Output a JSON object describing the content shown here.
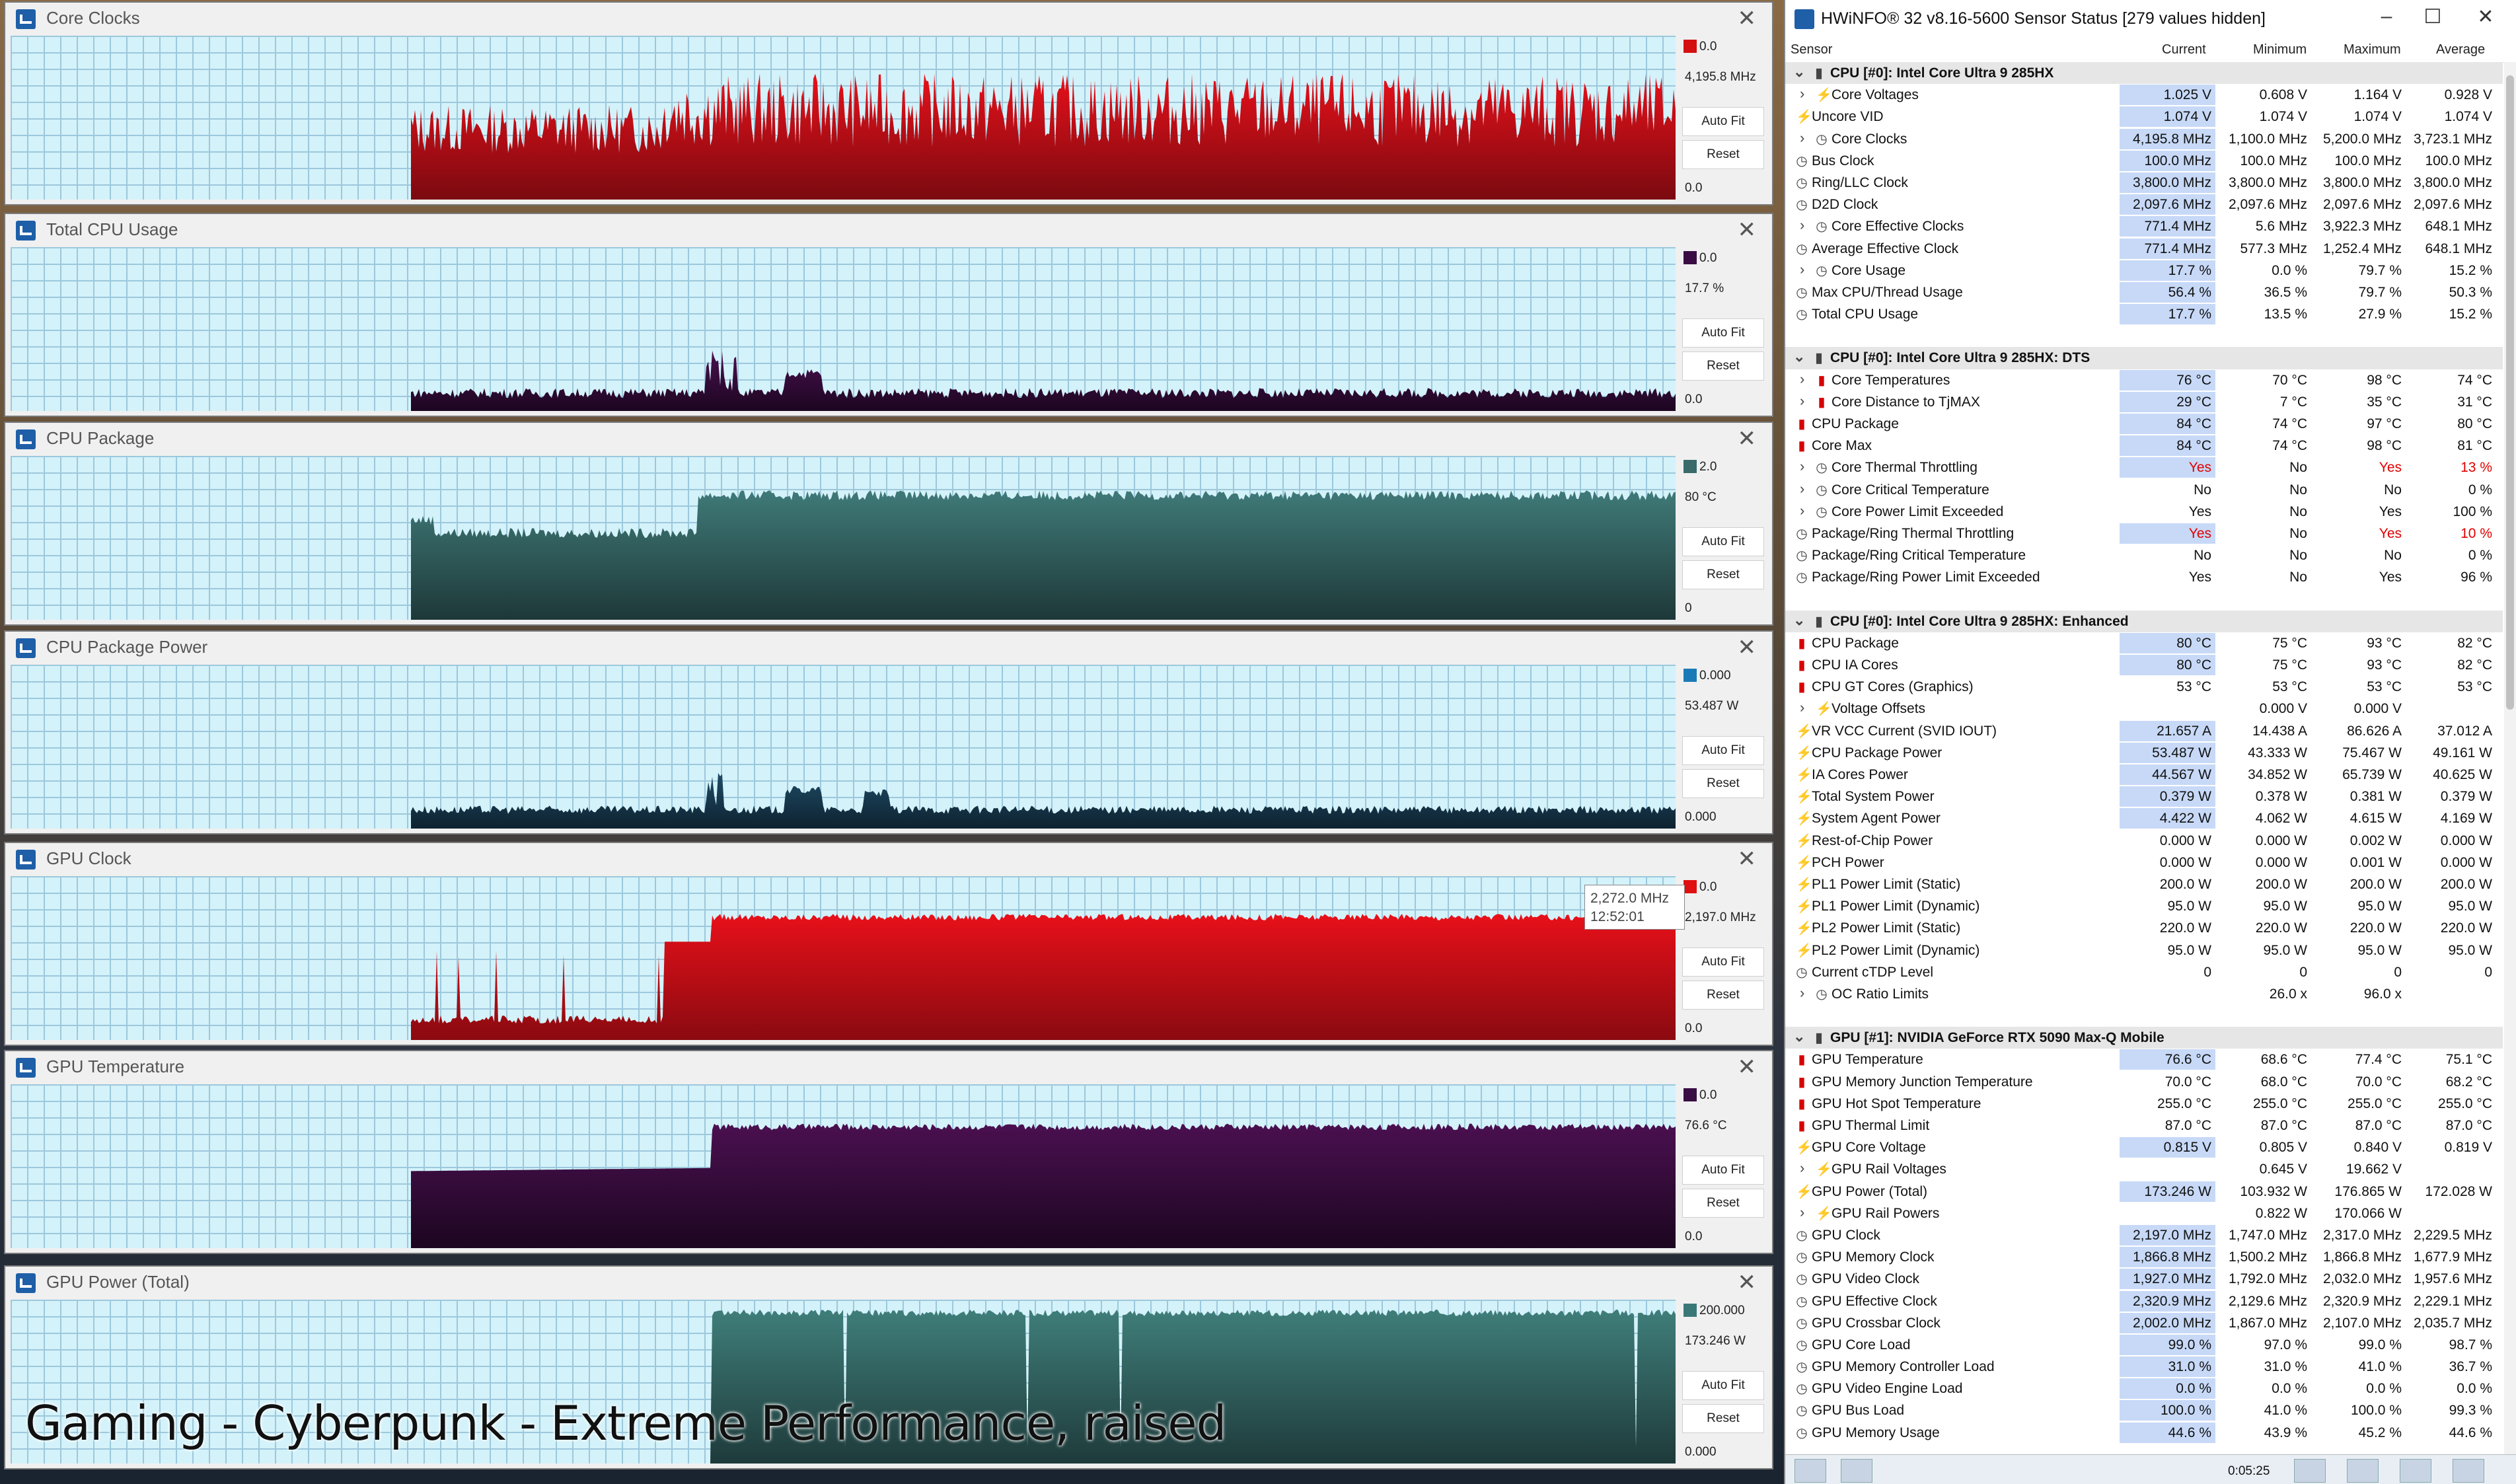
{
  "overlay_caption": "Gaming - Cyberpunk - Extreme Performance, raised",
  "graphs": [
    {
      "title": "Core Clocks",
      "max_label": "0.0",
      "current": "4,195.8 MHz",
      "min_label": "0.0",
      "color": "#d41010",
      "fill_top": "#e8101a",
      "fill_bot": "#7a0a10"
    },
    {
      "title": "Total CPU Usage",
      "max_label": "0.0",
      "current": "17.7 %",
      "min_label": "0.0",
      "color": "#3a0c44",
      "fill_top": "#4a1050",
      "fill_bot": "#1c0620"
    },
    {
      "title": "CPU Package",
      "max_label": "2.0",
      "current": "80 °C",
      "min_label": "0",
      "color": "#3a6a6a",
      "fill_top": "#3f7a78",
      "fill_bot": "#1e3838"
    },
    {
      "title": "CPU Package Power",
      "max_label": "0.000",
      "current": "53.487 W",
      "min_label": "0.000",
      "color": "#1a7ab8",
      "fill_top": "#1e4c66",
      "fill_bot": "#0e2230"
    },
    {
      "title": "GPU Clock",
      "max_label": "0.0",
      "current": "2,197.0 MHz",
      "min_label": "0.0",
      "color": "#e01010",
      "fill_top": "#e8101a",
      "fill_bot": "#8a0a10"
    },
    {
      "title": "GPU Temperature",
      "max_label": "0.0",
      "current": "76.6 °C",
      "min_label": "0.0",
      "color": "#3a0c44",
      "fill_top": "#4a1050",
      "fill_bot": "#1c0620"
    },
    {
      "title": "GPU Power (Total)",
      "max_label": "200.000",
      "current": "173.246 W",
      "min_label": "0.000",
      "color": "#3a7878",
      "fill_top": "#3f7e7a",
      "fill_bot": "#1e3a3a"
    }
  ],
  "graph_buttons": {
    "autofit": "Auto Fit",
    "reset": "Reset"
  },
  "tooltip": {
    "value": "2,272.0 MHz",
    "time": "12:52:01"
  },
  "sensor": {
    "title": "HWiNFO® 32 v8.16-5600 Sensor Status [279 values hidden]",
    "columns": {
      "sensor": "Sensor",
      "current": "Current",
      "minimum": "Minimum",
      "maximum": "Maximum",
      "average": "Average"
    },
    "uptime": "0:05:25",
    "rows": [
      {
        "t": "g",
        "name": "CPU [#0]: Intel Core Ultra 9 285HX"
      },
      {
        "name": "Core Voltages",
        "icon": "volt",
        "exp": true,
        "c": "1.025 V",
        "mn": "0.608 V",
        "mx": "1.164 V",
        "av": "0.928 V",
        "hl": true
      },
      {
        "name": "Uncore VID",
        "icon": "volt",
        "c": "1.074 V",
        "mn": "1.074 V",
        "mx": "1.074 V",
        "av": "1.074 V",
        "hl": true
      },
      {
        "name": "Core Clocks",
        "icon": "clk",
        "exp": true,
        "c": "4,195.8 MHz",
        "mn": "1,100.0 MHz",
        "mx": "5,200.0 MHz",
        "av": "3,723.1 MHz",
        "hl": true
      },
      {
        "name": "Bus Clock",
        "icon": "clk",
        "c": "100.0 MHz",
        "mn": "100.0 MHz",
        "mx": "100.0 MHz",
        "av": "100.0 MHz",
        "hl": true
      },
      {
        "name": "Ring/LLC Clock",
        "icon": "clk",
        "c": "3,800.0 MHz",
        "mn": "3,800.0 MHz",
        "mx": "3,800.0 MHz",
        "av": "3,800.0 MHz",
        "hl": true
      },
      {
        "name": "D2D Clock",
        "icon": "clk",
        "c": "2,097.6 MHz",
        "mn": "2,097.6 MHz",
        "mx": "2,097.6 MHz",
        "av": "2,097.6 MHz",
        "hl": true
      },
      {
        "name": "Core Effective Clocks",
        "icon": "clk",
        "exp": true,
        "c": "771.4 MHz",
        "mn": "5.6 MHz",
        "mx": "3,922.3 MHz",
        "av": "648.1 MHz",
        "hl": true
      },
      {
        "name": "Average Effective Clock",
        "icon": "clk",
        "c": "771.4 MHz",
        "mn": "577.3 MHz",
        "mx": "1,252.4 MHz",
        "av": "648.1 MHz",
        "hl": true
      },
      {
        "name": "Core Usage",
        "icon": "clk",
        "exp": true,
        "c": "17.7 %",
        "mn": "0.0 %",
        "mx": "79.7 %",
        "av": "15.2 %",
        "hl": true
      },
      {
        "name": "Max CPU/Thread Usage",
        "icon": "clk",
        "c": "56.4 %",
        "mn": "36.5 %",
        "mx": "79.7 %",
        "av": "50.3 %",
        "hl": true
      },
      {
        "name": "Total CPU Usage",
        "icon": "clk",
        "c": "17.7 %",
        "mn": "13.5 %",
        "mx": "27.9 %",
        "av": "15.2 %",
        "hl": true
      },
      {
        "t": "b"
      },
      {
        "t": "g",
        "name": "CPU [#0]: Intel Core Ultra 9 285HX: DTS"
      },
      {
        "name": "Core Temperatures",
        "icon": "temp",
        "exp": true,
        "c": "76 °C",
        "mn": "70 °C",
        "mx": "98 °C",
        "av": "74 °C",
        "hl": true
      },
      {
        "name": "Core Distance to TjMAX",
        "icon": "temp",
        "exp": true,
        "c": "29 °C",
        "mn": "7 °C",
        "mx": "35 °C",
        "av": "31 °C",
        "hl": true
      },
      {
        "name": "CPU Package",
        "icon": "temp",
        "c": "84 °C",
        "mn": "74 °C",
        "mx": "97 °C",
        "av": "80 °C",
        "hl": true
      },
      {
        "name": "Core Max",
        "icon": "temp",
        "c": "84 °C",
        "mn": "74 °C",
        "mx": "98 °C",
        "av": "81 °C",
        "hl": true
      },
      {
        "name": "Core Thermal Throttling",
        "icon": "clk",
        "exp": true,
        "c": "Yes",
        "mn": "No",
        "mx": "Yes",
        "av": "13 %",
        "hl": true,
        "red": true
      },
      {
        "name": "Core Critical Temperature",
        "icon": "clk",
        "exp": true,
        "c": "No",
        "mn": "No",
        "mx": "No",
        "av": "0 %"
      },
      {
        "name": "Core Power Limit Exceeded",
        "icon": "clk",
        "exp": true,
        "c": "Yes",
        "mn": "No",
        "mx": "Yes",
        "av": "100 %"
      },
      {
        "name": "Package/Ring Thermal Throttling",
        "icon": "clk",
        "c": "Yes",
        "mn": "No",
        "mx": "Yes",
        "av": "10 %",
        "hl": true,
        "red": true
      },
      {
        "name": "Package/Ring Critical Temperature",
        "icon": "clk",
        "c": "No",
        "mn": "No",
        "mx": "No",
        "av": "0 %"
      },
      {
        "name": "Package/Ring Power Limit Exceeded",
        "icon": "clk",
        "c": "Yes",
        "mn": "No",
        "mx": "Yes",
        "av": "96 %"
      },
      {
        "t": "b"
      },
      {
        "t": "g",
        "name": "CPU [#0]: Intel Core Ultra 9 285HX: Enhanced"
      },
      {
        "name": "CPU Package",
        "icon": "temp",
        "c": "80 °C",
        "mn": "75 °C",
        "mx": "93 °C",
        "av": "82 °C",
        "hl": true
      },
      {
        "name": "CPU IA Cores",
        "icon": "temp",
        "c": "80 °C",
        "mn": "75 °C",
        "mx": "93 °C",
        "av": "82 °C",
        "hl": true
      },
      {
        "name": "CPU GT Cores (Graphics)",
        "icon": "temp",
        "c": "53 °C",
        "mn": "53 °C",
        "mx": "53 °C",
        "av": "53 °C"
      },
      {
        "name": "Voltage Offsets",
        "icon": "volt",
        "exp": true,
        "c": "",
        "mn": "0.000 V",
        "mx": "0.000 V",
        "av": ""
      },
      {
        "name": "VR VCC Current (SVID IOUT)",
        "icon": "volt",
        "c": "21.657 A",
        "mn": "14.438 A",
        "mx": "86.626 A",
        "av": "37.012 A",
        "hl": true
      },
      {
        "name": "CPU Package Power",
        "icon": "volt",
        "c": "53.487 W",
        "mn": "43.333 W",
        "mx": "75.467 W",
        "av": "49.161 W",
        "hl": true
      },
      {
        "name": "IA Cores Power",
        "icon": "volt",
        "c": "44.567 W",
        "mn": "34.852 W",
        "mx": "65.739 W",
        "av": "40.625 W",
        "hl": true
      },
      {
        "name": "Total System Power",
        "icon": "volt",
        "c": "0.379 W",
        "mn": "0.378 W",
        "mx": "0.381 W",
        "av": "0.379 W",
        "hl": true
      },
      {
        "name": "System Agent Power",
        "icon": "volt",
        "c": "4.422 W",
        "mn": "4.062 W",
        "mx": "4.615 W",
        "av": "4.169 W",
        "hl": true
      },
      {
        "name": "Rest-of-Chip Power",
        "icon": "volt",
        "c": "0.000 W",
        "mn": "0.000 W",
        "mx": "0.002 W",
        "av": "0.000 W"
      },
      {
        "name": "PCH Power",
        "icon": "volt",
        "c": "0.000 W",
        "mn": "0.000 W",
        "mx": "0.001 W",
        "av": "0.000 W"
      },
      {
        "name": "PL1 Power Limit (Static)",
        "icon": "volt",
        "c": "200.0 W",
        "mn": "200.0 W",
        "mx": "200.0 W",
        "av": "200.0 W"
      },
      {
        "name": "PL1 Power Limit (Dynamic)",
        "icon": "volt",
        "c": "95.0 W",
        "mn": "95.0 W",
        "mx": "95.0 W",
        "av": "95.0 W"
      },
      {
        "name": "PL2 Power Limit (Static)",
        "icon": "volt",
        "c": "220.0 W",
        "mn": "220.0 W",
        "mx": "220.0 W",
        "av": "220.0 W"
      },
      {
        "name": "PL2 Power Limit (Dynamic)",
        "icon": "volt",
        "c": "95.0 W",
        "mn": "95.0 W",
        "mx": "95.0 W",
        "av": "95.0 W"
      },
      {
        "name": "Current cTDP Level",
        "icon": "clk",
        "c": "0",
        "mn": "0",
        "mx": "0",
        "av": "0"
      },
      {
        "name": "OC Ratio Limits",
        "icon": "clk",
        "exp": true,
        "c": "",
        "mn": "26.0 x",
        "mx": "96.0 x",
        "av": ""
      },
      {
        "t": "b"
      },
      {
        "t": "g",
        "name": "GPU [#1]: NVIDIA  GeForce RTX 5090 Max-Q Mobile"
      },
      {
        "name": "GPU Temperature",
        "icon": "temp",
        "c": "76.6 °C",
        "mn": "68.6 °C",
        "mx": "77.4 °C",
        "av": "75.1 °C",
        "hl": true
      },
      {
        "name": "GPU Memory Junction Temperature",
        "icon": "temp",
        "c": "70.0 °C",
        "mn": "68.0 °C",
        "mx": "70.0 °C",
        "av": "68.2 °C"
      },
      {
        "name": "GPU Hot Spot Temperature",
        "icon": "temp",
        "c": "255.0 °C",
        "mn": "255.0 °C",
        "mx": "255.0 °C",
        "av": "255.0 °C"
      },
      {
        "name": "GPU Thermal Limit",
        "icon": "temp",
        "c": "87.0 °C",
        "mn": "87.0 °C",
        "mx": "87.0 °C",
        "av": "87.0 °C"
      },
      {
        "name": "GPU Core Voltage",
        "icon": "volt",
        "c": "0.815 V",
        "mn": "0.805 V",
        "mx": "0.840 V",
        "av": "0.819 V",
        "hl": true
      },
      {
        "name": "GPU Rail Voltages",
        "icon": "volt",
        "exp": true,
        "c": "",
        "mn": "0.645 V",
        "mx": "19.662 V",
        "av": ""
      },
      {
        "name": "GPU Power (Total)",
        "icon": "volt",
        "c": "173.246 W",
        "mn": "103.932 W",
        "mx": "176.865 W",
        "av": "172.028 W",
        "hl": true
      },
      {
        "name": "GPU Rail Powers",
        "icon": "volt",
        "exp": true,
        "c": "",
        "mn": "0.822 W",
        "mx": "170.066 W",
        "av": ""
      },
      {
        "name": "GPU Clock",
        "icon": "clk",
        "c": "2,197.0 MHz",
        "mn": "1,747.0 MHz",
        "mx": "2,317.0 MHz",
        "av": "2,229.5 MHz",
        "hl": true
      },
      {
        "name": "GPU Memory Clock",
        "icon": "clk",
        "c": "1,866.8 MHz",
        "mn": "1,500.2 MHz",
        "mx": "1,866.8 MHz",
        "av": "1,677.9 MHz",
        "hl": true
      },
      {
        "name": "GPU Video Clock",
        "icon": "clk",
        "c": "1,927.0 MHz",
        "mn": "1,792.0 MHz",
        "mx": "2,032.0 MHz",
        "av": "1,957.6 MHz",
        "hl": true
      },
      {
        "name": "GPU Effective Clock",
        "icon": "clk",
        "c": "2,320.9 MHz",
        "mn": "2,129.6 MHz",
        "mx": "2,320.9 MHz",
        "av": "2,229.1 MHz",
        "hl": true
      },
      {
        "name": "GPU Crossbar Clock",
        "icon": "clk",
        "c": "2,002.0 MHz",
        "mn": "1,867.0 MHz",
        "mx": "2,107.0 MHz",
        "av": "2,035.7 MHz",
        "hl": true
      },
      {
        "name": "GPU Core Load",
        "icon": "clk",
        "c": "99.0 %",
        "mn": "97.0 %",
        "mx": "99.0 %",
        "av": "98.7 %",
        "hl": true
      },
      {
        "name": "GPU Memory Controller Load",
        "icon": "clk",
        "c": "31.0 %",
        "mn": "31.0 %",
        "mx": "41.0 %",
        "av": "36.7 %",
        "hl": true
      },
      {
        "name": "GPU Video Engine Load",
        "icon": "clk",
        "c": "0.0 %",
        "mn": "0.0 %",
        "mx": "0.0 %",
        "av": "0.0 %",
        "hl": true
      },
      {
        "name": "GPU Bus Load",
        "icon": "clk",
        "c": "100.0 %",
        "mn": "41.0 %",
        "mx": "100.0 %",
        "av": "99.3 %",
        "hl": true
      },
      {
        "name": "GPU Memory Usage",
        "icon": "clk",
        "c": "44.6 %",
        "mn": "43.9 %",
        "mx": "45.2 %",
        "av": "44.6 %",
        "hl": true
      }
    ]
  }
}
